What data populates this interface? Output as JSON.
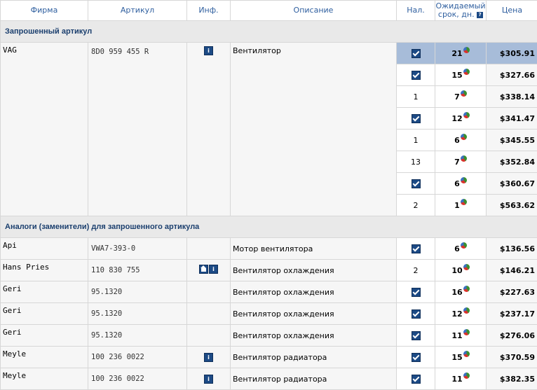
{
  "header": {
    "firm": "Фирма",
    "article": "Артикул",
    "info": "Инф.",
    "description": "Описание",
    "availability": "Нал.",
    "term_line1": "Ожидаемый",
    "term_line2": "срок, дн.",
    "price": "Цена"
  },
  "section_requested": "Запрошенный артикул",
  "requested": {
    "firm": "VAG",
    "article": "8D0 959 455 R",
    "info_icons": [
      "info-icon"
    ],
    "description": "Вентилятор",
    "offers": [
      {
        "avail": "check",
        "term": "21",
        "price": "$305.91",
        "selected": true
      },
      {
        "avail": "check",
        "term": "15",
        "price": "$327.66"
      },
      {
        "avail": "1",
        "term": "7",
        "price": "$338.14"
      },
      {
        "avail": "check",
        "term": "12",
        "price": "$341.47"
      },
      {
        "avail": "1",
        "term": "6",
        "price": "$345.55"
      },
      {
        "avail": "13",
        "term": "7",
        "price": "$352.84"
      },
      {
        "avail": "check",
        "term": "6",
        "price": "$360.67"
      },
      {
        "avail": "2",
        "term": "1",
        "price": "$563.62"
      }
    ]
  },
  "section_analogs": "Аналоги (заменители) для запрошенного артикула",
  "analogs": [
    {
      "firm": "Api",
      "article": "VWA7-393-0",
      "info_icons": [],
      "description": "Мотор вентилятора",
      "avail": "check",
      "term": "6",
      "price": "$136.56"
    },
    {
      "firm": "Hans Pries",
      "article": "110 830 755",
      "info_icons": [
        "photo-icon",
        "info-icon"
      ],
      "description": "Вентилятор охлаждения",
      "avail": "2",
      "term": "10",
      "price": "$146.21"
    },
    {
      "firm": "Geri",
      "article": "95.1320",
      "info_icons": [],
      "description": "Вентилятор охлаждения",
      "avail": "check",
      "term": "16",
      "price": "$227.63"
    },
    {
      "firm": "Geri",
      "article": "95.1320",
      "info_icons": [],
      "description": "Вентилятор охлаждения",
      "avail": "check",
      "term": "12",
      "price": "$237.17"
    },
    {
      "firm": "Geri",
      "article": "95.1320",
      "info_icons": [],
      "description": "Вентилятор охлаждения",
      "avail": "check",
      "term": "11",
      "price": "$276.06"
    },
    {
      "firm": "Meyle",
      "article": "100 236 0022",
      "info_icons": [
        "info-icon"
      ],
      "description": "Вентилятор радиатора",
      "avail": "check",
      "term": "15",
      "price": "$370.59"
    },
    {
      "firm": "Meyle",
      "article": "100 236 0022",
      "info_icons": [
        "info-icon"
      ],
      "description": "Вентилятор радиатора",
      "avail": "check",
      "term": "11",
      "price": "$382.35"
    }
  ],
  "colors": {
    "selected_row": "#a7bcd9",
    "header_text": "#2f5f9f",
    "section_bg": "#e9e9e9"
  }
}
